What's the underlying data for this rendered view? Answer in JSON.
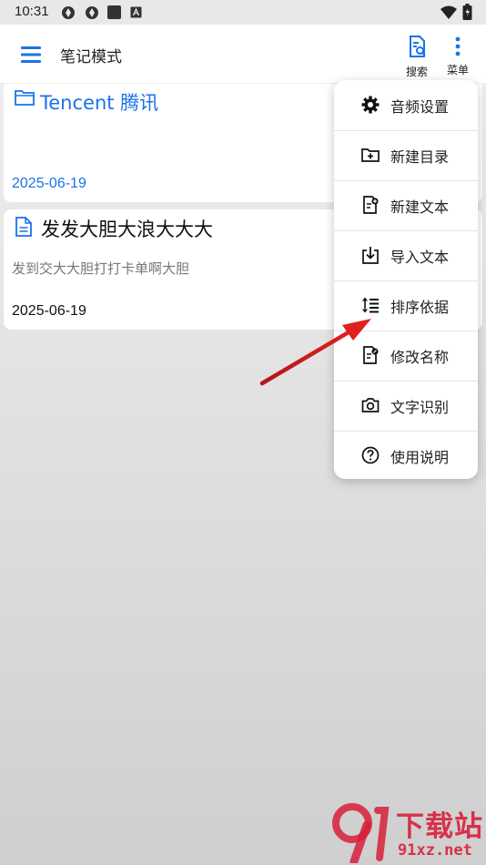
{
  "status": {
    "time": "10:31"
  },
  "app_bar": {
    "title": "笔记模式",
    "search_label": "搜索",
    "menu_label": "菜单"
  },
  "cards": [
    {
      "title": "Tencent 腾讯",
      "date": "2025-06-19",
      "title_color": "#1a73e8",
      "date_color": "#1a73e8"
    },
    {
      "title": "发发大胆大浪大大大",
      "subtitle": "发到交大大胆打打卡单啊大胆",
      "date": "2025-06-19"
    }
  ],
  "menu": [
    {
      "label": "音频设置",
      "icon": "gear-icon"
    },
    {
      "label": "新建目录",
      "icon": "new-folder-icon"
    },
    {
      "label": "新建文本",
      "icon": "new-document-icon"
    },
    {
      "label": "导入文本",
      "icon": "import-icon"
    },
    {
      "label": "排序依据",
      "icon": "sort-icon"
    },
    {
      "label": "修改名称",
      "icon": "rename-icon"
    },
    {
      "label": "文字识别",
      "icon": "camera-icon"
    },
    {
      "label": "使用说明",
      "icon": "help-icon"
    }
  ],
  "watermark": {
    "brand": "下载站",
    "site": "91xz.net"
  },
  "colors": {
    "accent": "#1a73e8",
    "annotation_arrow": "#e0201c"
  }
}
